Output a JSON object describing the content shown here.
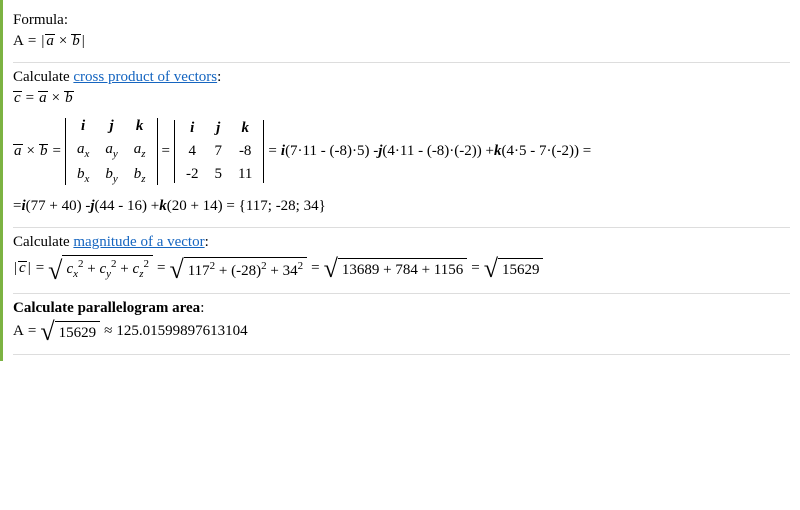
{
  "formula_label": "Formula:",
  "A_sym": "A",
  "eq": "=",
  "approx": "≈",
  "cross": "×",
  "pipe": "|",
  "a_sym": "a",
  "b_sym": "b",
  "c_sym": "c",
  "calc_cross_prefix": "Calculate ",
  "calc_cross_link": "cross product of vectors",
  "colon": ":",
  "i": "i",
  "j": "j",
  "k": "k",
  "ax": "a",
  "ay": "a",
  "az": "a",
  "bx": "b",
  "by": "b",
  "bz": "b",
  "sx": "x",
  "sy": "y",
  "sz": "z",
  "det2": {
    "r1": [
      "i",
      "j",
      "k"
    ],
    "r2": [
      "4",
      "7",
      "-8"
    ],
    "r3": [
      "-2",
      "5",
      "11"
    ]
  },
  "expand1": "(7·11 - (-8)·5) - ",
  "expand2": "(4·11 - (-8)·(-2)) + ",
  "expand3": "(4·5 - 7·(-2)) =",
  "expand_pre_i": " ",
  "line_simplify_pre": "= ",
  "sim_i": "(77 + 40) - ",
  "sim_j": "(44 - 16) + ",
  "sim_k": "(20 + 14) = {117; -28; 34}",
  "calc_mag_prefix": "Calculate ",
  "calc_mag_link": "magnitude of a vector",
  "mag_terms_sym": {
    "cx": "c",
    "cy": "c",
    "cz": "c",
    "two": "2"
  },
  "plus": " + ",
  "mag_numeric1": "117",
  "mag_numeric2": "(-28)",
  "mag_numeric3": "34",
  "mag_sum": "13689 + 784 + 1156",
  "mag_result": "15629",
  "calc_area_label": "Calculate parallelogram area",
  "area_value": "15629",
  "area_approx": "125.01599897613104",
  "chart_data": {
    "type": "table",
    "title": "Cross product and parallelogram area computation",
    "vectors": {
      "a": [
        4,
        7,
        -8
      ],
      "b": [
        -2,
        5,
        11
      ]
    },
    "cross_product_c": [
      117,
      -28,
      34
    ],
    "magnitude_squared_terms": [
      13689,
      784,
      1156
    ],
    "magnitude_squared_sum": 15629,
    "area": 125.01599897613104
  }
}
